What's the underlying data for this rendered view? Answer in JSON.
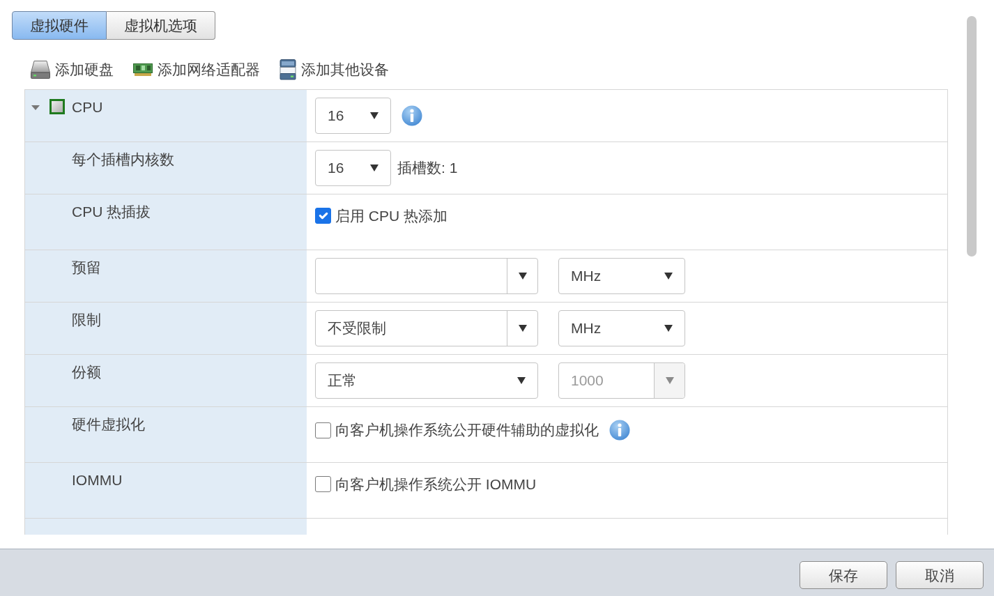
{
  "tabs": [
    {
      "label": "虚拟硬件",
      "selected": true
    },
    {
      "label": "虚拟机选项",
      "selected": false
    }
  ],
  "toolbar": [
    {
      "kind": "disk",
      "label": "添加硬盘"
    },
    {
      "kind": "network",
      "label": "添加网络适配器"
    },
    {
      "kind": "device",
      "label": "添加其他设备"
    }
  ],
  "settings": [
    {
      "label": "CPU",
      "kind": "cpu",
      "expanded": true,
      "controls": [
        {
          "kind": "select",
          "value": "16",
          "disabled": false
        },
        {
          "kind": "info"
        }
      ],
      "children": [
        {
          "label": "每个插槽内核数",
          "controls": [
            {
              "kind": "select",
              "value": "16",
              "disabled": false
            },
            {
              "kind": "note",
              "text": "插槽数: 1"
            }
          ]
        },
        {
          "label": "CPU 热插拔",
          "controls": [
            {
              "kind": "checkbox",
              "label": "启用 CPU 热添加",
              "checked": true
            }
          ]
        },
        {
          "label": "预留",
          "controls": [
            {
              "kind": "combo",
              "disabled": false
            },
            {
              "kind": "select",
              "value": "MHz",
              "disabled": false
            }
          ]
        },
        {
          "label": "限制",
          "controls": [
            {
              "kind": "combo",
              "value": "不受限制",
              "disabled": false
            },
            {
              "kind": "select",
              "value": "MHz",
              "disabled": false
            }
          ]
        },
        {
          "label": "份额",
          "controls": [
            {
              "kind": "select",
              "value": "正常",
              "disabled": false
            },
            {
              "kind": "combo",
              "value": "1000",
              "disabled": true
            }
          ]
        },
        {
          "label": "硬件虚拟化",
          "controls": [
            {
              "kind": "checkbox",
              "label": "向客户机操作系统公开硬件辅助的虚拟化",
              "checked": false
            },
            {
              "kind": "info"
            }
          ]
        },
        {
          "label": "IOMMU",
          "controls": [
            {
              "kind": "checkbox",
              "label": "向客户机操作系统公开 IOMMU",
              "checked": false
            }
          ]
        }
      ]
    }
  ],
  "buttons": [
    "保存",
    "取消"
  ]
}
